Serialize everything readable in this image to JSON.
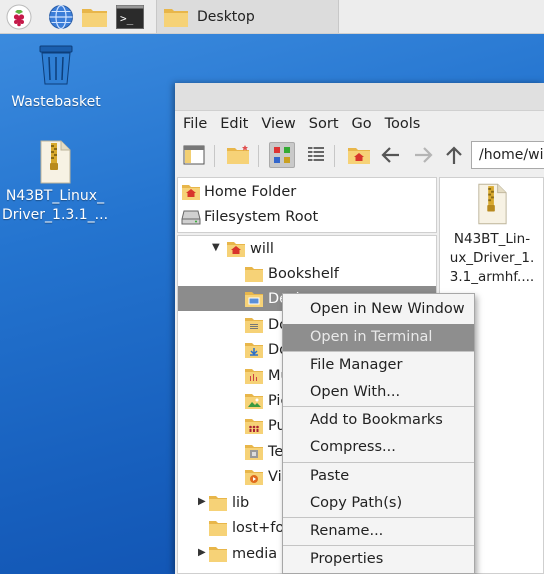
{
  "taskbar": {
    "launchers": [
      "raspberry-menu-icon",
      "web-browser-icon",
      "file-manager-icon",
      "terminal-icon"
    ],
    "active_task": {
      "icon": "folder-icon",
      "label": "Desktop"
    }
  },
  "desktop": {
    "icons": [
      {
        "name": "wastebasket",
        "icon": "trash-icon",
        "label": "Wastebasket"
      },
      {
        "name": "driver-archive",
        "icon": "zip-file-icon",
        "label_line1": "N43BT_Linux_",
        "label_line2": "Driver_1.3.1_..."
      }
    ]
  },
  "file_manager": {
    "menu": [
      "File",
      "Edit",
      "View",
      "Sort",
      "Go",
      "Tools"
    ],
    "path": "/home/will",
    "places": [
      {
        "label": "Home Folder",
        "icon": "home-icon"
      },
      {
        "label": "Filesystem Root",
        "icon": "drive-icon"
      }
    ],
    "tree": [
      {
        "label": "will",
        "icon": "home-folder-icon",
        "expanded": true
      },
      {
        "label": "Bookshelf",
        "icon": "folder-icon"
      },
      {
        "label": "Desktop",
        "icon": "desktop-folder-icon",
        "selected": true
      },
      {
        "label": "Documents",
        "icon": "documents-folder-icon"
      },
      {
        "label": "Downloads",
        "icon": "downloads-folder-icon"
      },
      {
        "label": "Music",
        "icon": "music-folder-icon"
      },
      {
        "label": "Pictures",
        "icon": "pictures-folder-icon"
      },
      {
        "label": "Public",
        "icon": "public-folder-icon"
      },
      {
        "label": "Templates",
        "icon": "templates-folder-icon"
      },
      {
        "label": "Videos",
        "icon": "videos-folder-icon"
      },
      {
        "label": "lib",
        "icon": "folder-icon",
        "collapsed": true
      },
      {
        "label": "lost+found",
        "icon": "folder-icon"
      },
      {
        "label": "media",
        "icon": "folder-icon",
        "collapsed": true
      }
    ],
    "file": {
      "line1": "N43BT_Lin-",
      "line2": "ux_Driver_1.",
      "line3": "3.1_armhf...."
    }
  },
  "context_menu": {
    "items": [
      "Open in New Window",
      "Open in Terminal",
      "File Manager",
      "Open With...",
      "Add to Bookmarks",
      "Compress...",
      "Paste",
      "Copy Path(s)",
      "Rename...",
      "Properties"
    ],
    "highlighted": "Open in Terminal"
  },
  "colors": {
    "desktop_bg": "#1f6cc9",
    "folder": "#f4c95d",
    "selection": "#8c8c8c"
  }
}
